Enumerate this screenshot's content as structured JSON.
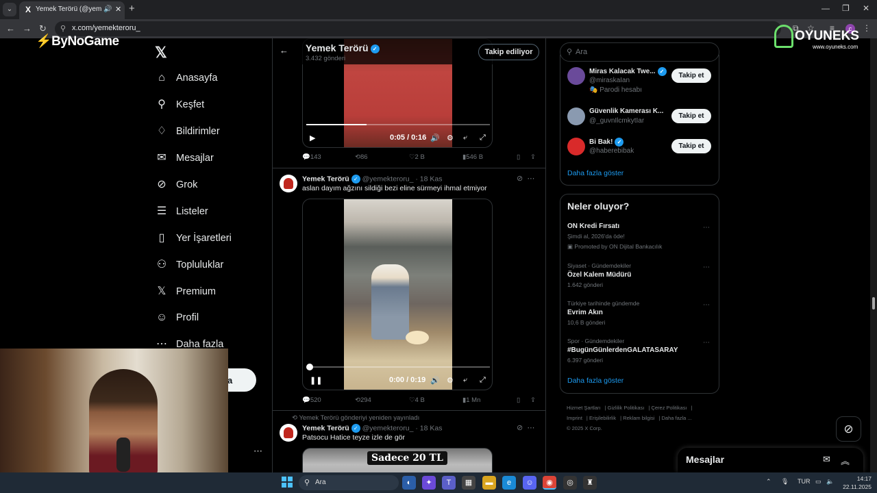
{
  "browser": {
    "tab_title": "Yemek Terörü (@yemekteroru_)",
    "url": "x.com/yemekteroru_",
    "profile_initial": "c"
  },
  "overlays": {
    "bynogame": "ByNoGame",
    "oyuneks": "OYUNEKS",
    "oyuneks_sub": "www.oyuneks.com"
  },
  "nav": {
    "home": "Anasayfa",
    "explore": "Keşfet",
    "notifications": "Bildirimler",
    "messages": "Mesajlar",
    "grok": "Grok",
    "lists": "Listeler",
    "bookmarks": "Yer İşaretleri",
    "communities": "Topluluklar",
    "premium": "Premium",
    "profile": "Profil",
    "more": "Daha fazla",
    "post_button": "a"
  },
  "profile_header": {
    "name": "Yemek Terörü",
    "posts": "3.432 gönderi",
    "follow_label": "Takip ediliyor"
  },
  "tweet1": {
    "video_time": "0:05 / 0:16",
    "progress": 0.33,
    "replies": "143",
    "reposts": "86",
    "likes": "2 B",
    "views": "546 B"
  },
  "tweet2": {
    "name": "Yemek Terörü",
    "handle": "@yemekteroru_",
    "date": "· 18 Kas",
    "text": "aslan dayım ağzını sildiği bezi eline sürmeyi ihmal etmiyor",
    "video_time": "0:00 / 0:19",
    "progress": 0.0,
    "replies": "520",
    "reposts": "294",
    "likes": "4 B",
    "views": "1 Mn"
  },
  "tweet3": {
    "repost_note": "Yemek Terörü gönderiyi yeniden yayınladı",
    "name": "Yemek Terörü",
    "handle": "@yemekteroru_",
    "date": "· 18 Kas",
    "text": "Patsocu Hatice teyze izle de gör",
    "video_caption": "Sadece 20 TL"
  },
  "right": {
    "search_placeholder": "Ara",
    "who_to_follow": [
      {
        "name": "Miras Kalacak Twe...",
        "handle": "@miraskaIan",
        "extra": "Parodi hesabı",
        "button": "Takip et",
        "color": "#6a4a9a"
      },
      {
        "name": "Güvenlik Kamerası K...",
        "handle": "@_guvnIlcmkytIar",
        "extra": "",
        "button": "Takip et",
        "color": "#8a9ab0"
      },
      {
        "name": "Bi Bak!",
        "handle": "@haberebibak",
        "extra": "",
        "button": "Takip et",
        "color": "#d92a2a"
      }
    ],
    "show_more": "Daha fazla göster",
    "trends_title": "Neler oluyor?",
    "trends": [
      {
        "meta": "",
        "topic": "ON Kredi Fırsatı",
        "count": "Şimdi al, 2026'da öde!",
        "promo": "Promoted by ON Dijital Bankacılık"
      },
      {
        "meta": "Siyaset · Gündemdekiler",
        "topic": "Özel Kalem Müdürü",
        "count": "1.642 gönderi",
        "promo": ""
      },
      {
        "meta": "Türkiye tarihinde gündemde",
        "topic": "Evrim Akın",
        "count": "10,6 B gönderi",
        "promo": ""
      },
      {
        "meta": "Spor · Gündemdekiler",
        "topic": "#BugünGünlerdenGALATASARAY",
        "count": "6.397 gönderi",
        "promo": ""
      }
    ],
    "trends_more": "Daha fazla göster",
    "footer": [
      "Hizmet Şartları",
      "Gizlilik Politikası",
      "Çerez Politikası",
      "Imprint",
      "Erişilebilirlik",
      "Reklam bilgisi",
      "Daha fazla ...",
      "© 2025 X Corp."
    ]
  },
  "messages_drawer": "Mesajlar",
  "taskbar": {
    "search_placeholder": "Ara",
    "lang": "TUR",
    "time": "14:17",
    "date": "22.11.2025"
  }
}
